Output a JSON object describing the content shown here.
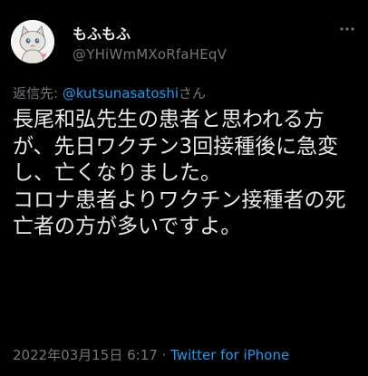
{
  "tweet": {
    "author": {
      "display_name": "もふもふ",
      "handle": "@YHiWmMXoRfaHEqV"
    },
    "more_icon": "more-dots-icon",
    "reply": {
      "prefix": "返信先: ",
      "mention": "@kutsunasatoshi",
      "suffix": "さん"
    },
    "text": "長尾和弘先生の患者と思われる方が、先日ワクチン3回接種後に急変し、亡くなりました。\nコロナ患者よりワクチン接種者の死亡者の方が多いですよ。",
    "meta": {
      "timestamp": "2022年03月15日 6:17",
      "separator": " · ",
      "source": "Twitter for iPhone"
    }
  },
  "colors": {
    "background": "#000000",
    "text": "#e7e9ea",
    "secondary": "#71767b",
    "link": "#1d9bf0"
  }
}
